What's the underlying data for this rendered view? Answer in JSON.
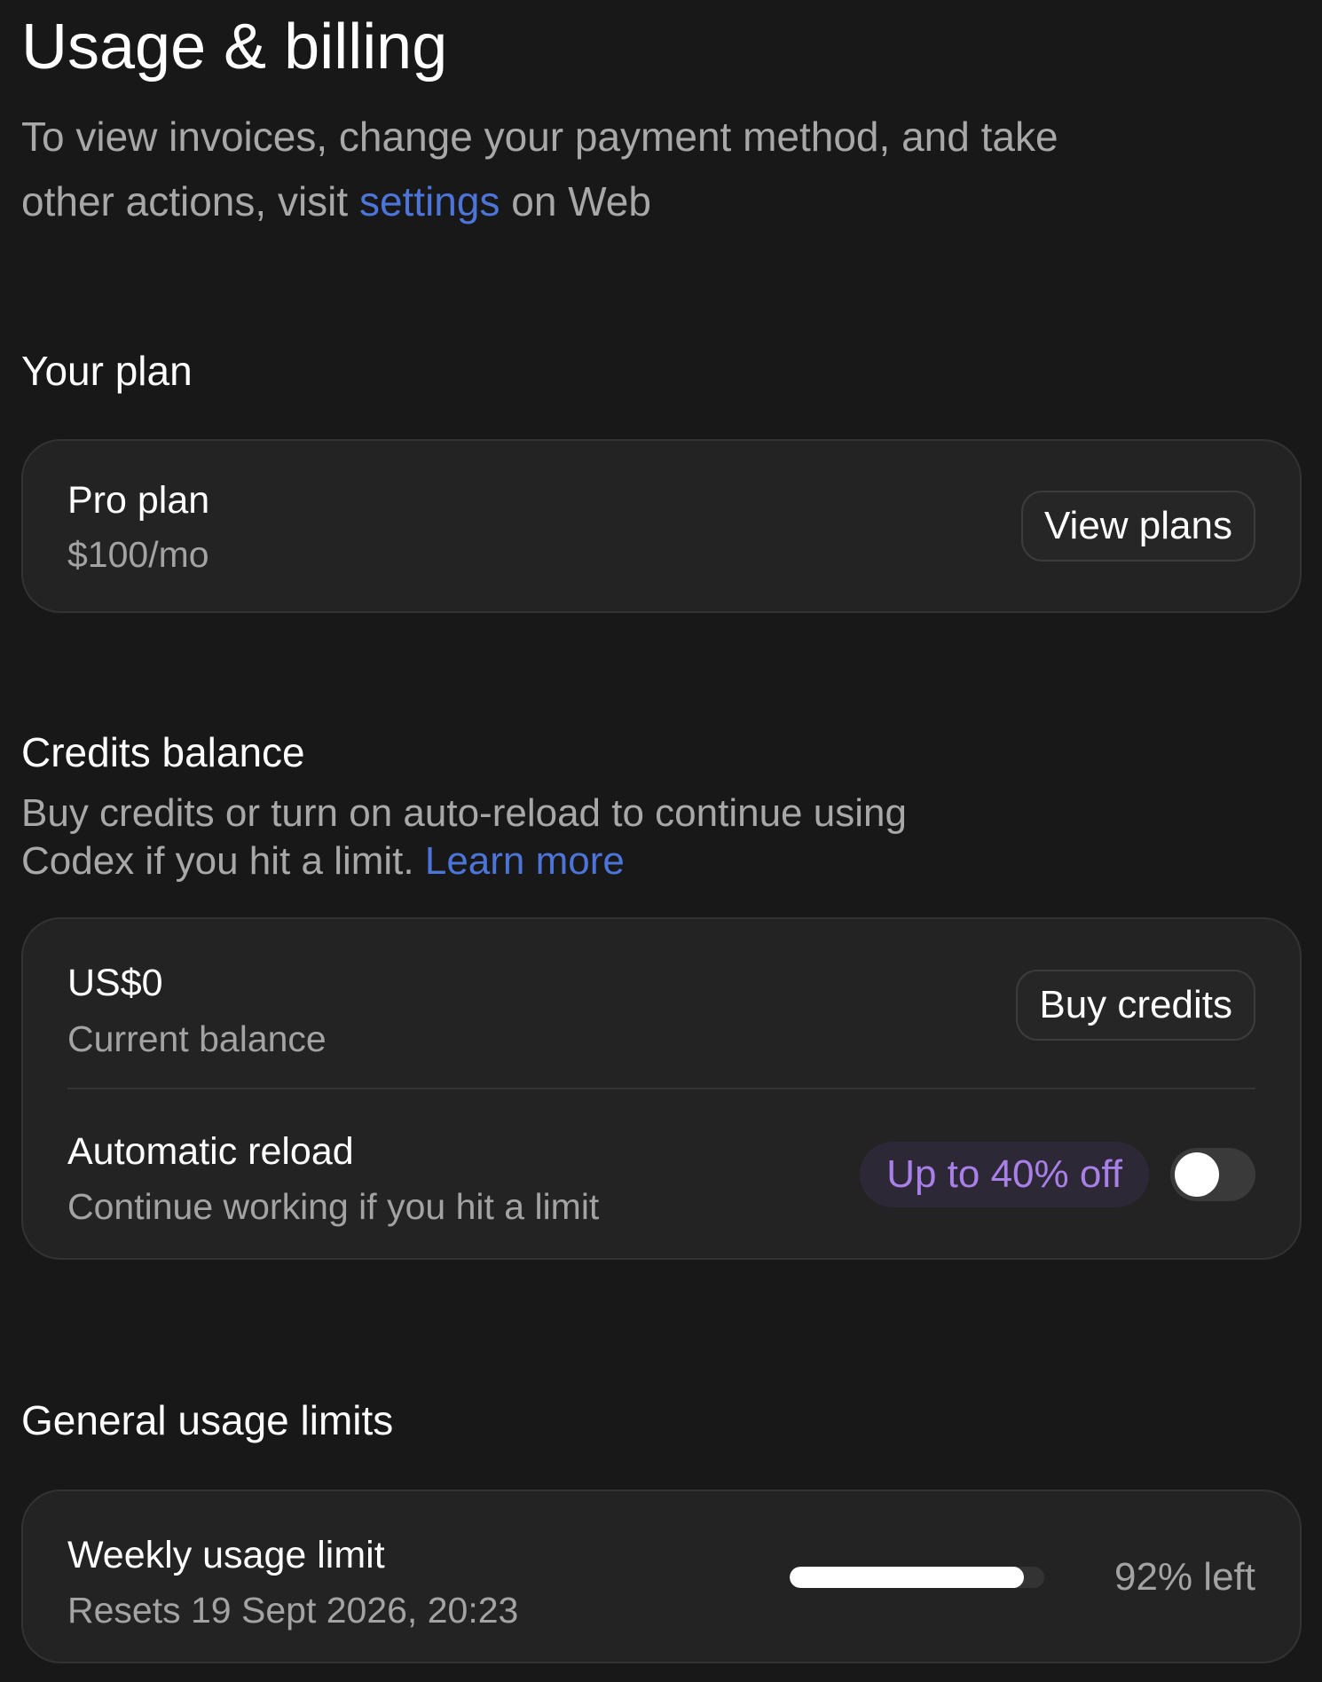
{
  "page": {
    "title": "Usage & billing",
    "subtitle_text_1": "To view invoices, change your payment method, and take other actions, visit ",
    "subtitle_link": "settings",
    "subtitle_text_2": " on Web"
  },
  "plan_section": {
    "title": "Your plan",
    "plan_name": "Pro plan",
    "plan_price": "$100/mo",
    "view_plans_label": "View plans"
  },
  "credits_section": {
    "title": "Credits balance",
    "description_text": "Buy credits or turn on auto-reload to continue using Codex if you hit a limit. ",
    "learn_more_link": "Learn more",
    "balance_amount": "US$0",
    "balance_label": "Current balance",
    "buy_credits_label": "Buy credits",
    "auto_reload_title": "Automatic reload",
    "auto_reload_subtitle": "Continue working if you hit a limit",
    "discount_badge": "Up to 40% off",
    "auto_reload_enabled": false
  },
  "usage_section": {
    "title": "General usage limits",
    "weekly_limit_title": "Weekly usage limit",
    "weekly_limit_reset": "Resets 19 Sept 2026, 20:23",
    "weekly_limit_remaining_text": "92% left",
    "weekly_limit_remaining_fraction": 0.92
  },
  "colors": {
    "background": "#181818",
    "card_background": "#232323",
    "link": "#4d74d9",
    "badge_text": "#a880e8",
    "badge_background": "#2d2836"
  }
}
